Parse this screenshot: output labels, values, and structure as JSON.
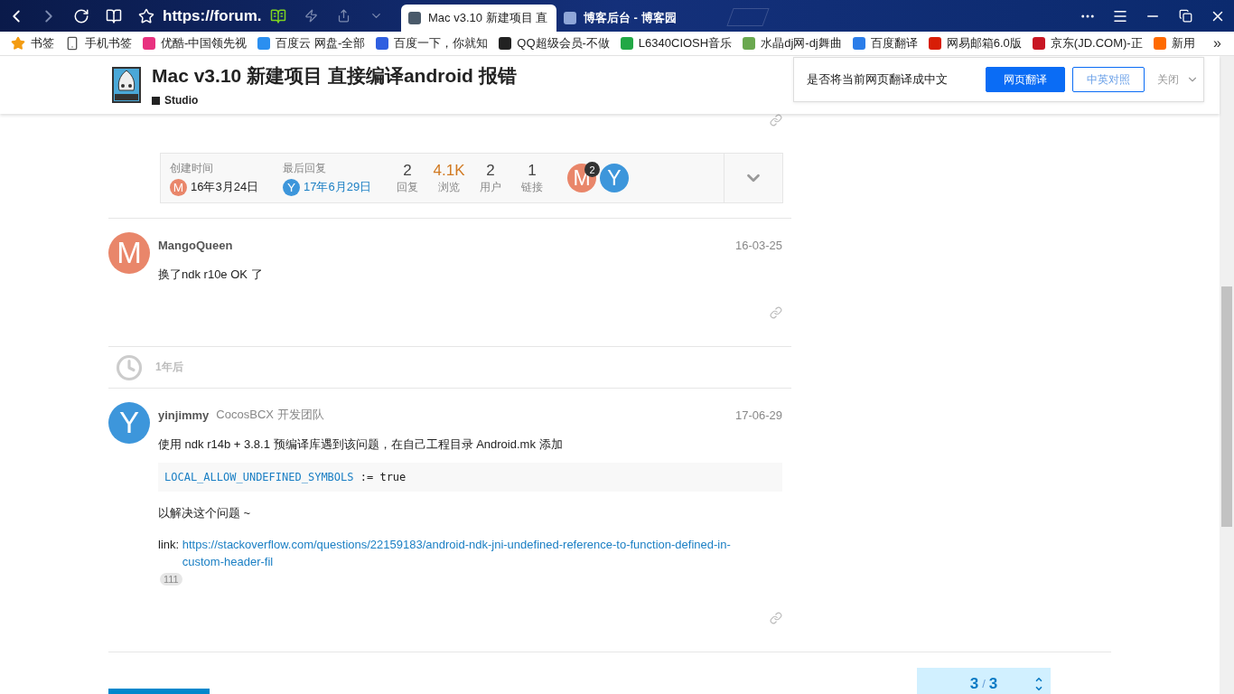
{
  "browser": {
    "address": "https://forum.",
    "tabs": [
      {
        "title": "Mac v3.10 新建项目 直",
        "selected": true
      },
      {
        "title": "博客后台 - 博客园",
        "selected": false
      }
    ],
    "bookmarks": [
      {
        "kind": "star",
        "label": "书签"
      },
      {
        "kind": "phone",
        "label": "手机书签"
      },
      {
        "kind": "site",
        "label": "优酷-中国领先视",
        "color": "#e8317f"
      },
      {
        "kind": "site",
        "label": "百度云 网盘-全部",
        "color": "#2b8ff0"
      },
      {
        "kind": "site",
        "label": "百度一下，你就知",
        "color": "#2f5fe0"
      },
      {
        "kind": "site",
        "label": "QQ超级会员-不做",
        "color": "#222222"
      },
      {
        "kind": "site",
        "label": "L6340CIOSH音乐",
        "color": "#22a845"
      },
      {
        "kind": "site",
        "label": "水晶dj网-dj舞曲",
        "color": "#6aa84f"
      },
      {
        "kind": "site",
        "label": "百度翻译",
        "color": "#2b7de9"
      },
      {
        "kind": "site",
        "label": "网易邮箱6.0版",
        "color": "#d81e06"
      },
      {
        "kind": "site",
        "label": "京东(JD.COM)-正",
        "color": "#c81623"
      },
      {
        "kind": "site",
        "label": "新用",
        "color": "#ff6a00"
      }
    ],
    "more_bookmarks": "»"
  },
  "topic": {
    "title": "Mac v3.10 新建项目 直接编译android 报错",
    "category": "Studio"
  },
  "translate_bar": {
    "prompt": "是否将当前网页翻译成中文",
    "translate": "网页翻译",
    "bilingual": "中英对照",
    "close": "关闭"
  },
  "topic_map": {
    "created": {
      "label": "创建时间",
      "avatar": {
        "letter": "M",
        "color": "#e9866a"
      },
      "date": "16年3月24日"
    },
    "last_reply": {
      "label": "最后回复",
      "avatar": {
        "letter": "Y",
        "color": "#3d96db"
      },
      "date": "17年6月29日"
    },
    "stats": [
      {
        "value": "2",
        "label": "回复",
        "color": "#444444"
      },
      {
        "value": "4.1K",
        "label": "浏览",
        "color": "#d17a22"
      },
      {
        "value": "2",
        "label": "用户",
        "color": "#444444"
      },
      {
        "value": "1",
        "label": "链接",
        "color": "#444444"
      }
    ],
    "participants": [
      {
        "letter": "M",
        "color": "#e9866a",
        "count": "2"
      },
      {
        "letter": "Y",
        "color": "#3d96db"
      }
    ]
  },
  "posts": [
    {
      "avatar": {
        "letter": "M",
        "color": "#e9866a"
      },
      "username": "MangoQueen",
      "date": "16-03-25",
      "body": [
        {
          "kind": "text",
          "text": "换了ndk r10e OK 了"
        }
      ]
    },
    {
      "kind": "gap",
      "text": "1年后"
    },
    {
      "avatar": {
        "letter": "Y",
        "color": "#3d96db"
      },
      "username": "yinjimmy",
      "group": "CocosBCX 开发团队",
      "date": "17-06-29",
      "body": [
        {
          "kind": "text",
          "text": "使用 ndk r14b + 3.8.1 预编译库遇到该问题，在自己工程目录 Android.mk 添加"
        },
        {
          "kind": "code",
          "identifier": "LOCAL_ALLOW_UNDEFINED_SYMBOLS",
          "rest": " := true"
        },
        {
          "kind": "text",
          "text": "以解决这个问题 ~"
        },
        {
          "kind": "link",
          "prefix": "link:",
          "url": "https://stackoverflow.com/questions/22159183/android-ndk-jni-undefined-reference-to-function-defined-in-custom-header-fil",
          "clicks": "111"
        }
      ]
    }
  ],
  "progress": {
    "current": "3",
    "separator": "/",
    "total": "3"
  }
}
